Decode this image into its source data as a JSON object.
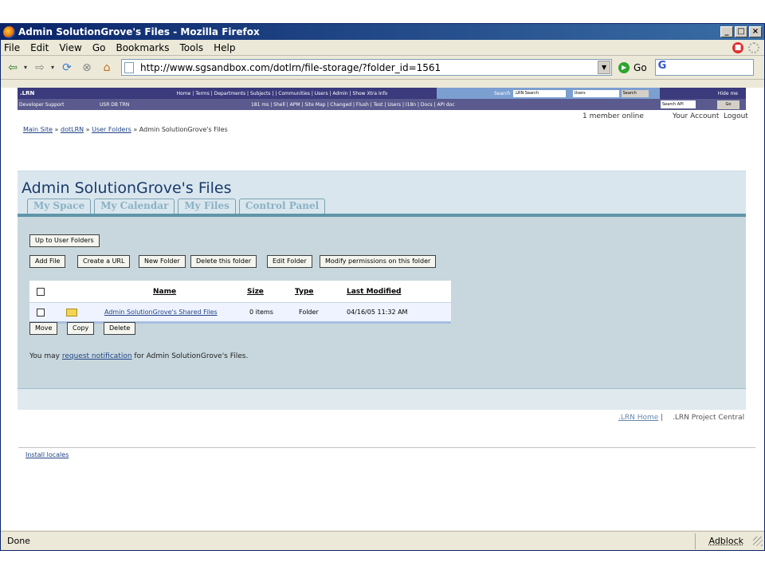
{
  "window": {
    "title": "Admin SolutionGrove's Files - Mozilla Firefox"
  },
  "menu": [
    "File",
    "Edit",
    "View",
    "Go",
    "Bookmarks",
    "Tools",
    "Help"
  ],
  "nav": {
    "url": "http://www.sgsandbox.com/dotlrn/file-storage/?folder_id=1561",
    "go_label": "Go",
    "search_logo": "G"
  },
  "lrn_toolbar": {
    "brand": ".LRN",
    "links": "Home | Terms | Departments | Subjects | | Communities | Users | Admin | Show Xtra Info",
    "search_label": "Search",
    "search_value": ".LRN Search",
    "select_value": "Users",
    "search_button": "Search",
    "hide": "Hide me"
  },
  "dev_toolbar": {
    "dev": "Developer Support",
    "usr": "USR DB TRN",
    "tools": "181 ms | Shell | APM | Site Map | Changed | Flush | Test | Users | I18n | Docs | API doc",
    "api_value": "Search API",
    "api_go": "Go"
  },
  "top_links": {
    "online": "1 member online",
    "account": "Your Account",
    "logout": "Logout"
  },
  "breadcrumb": {
    "main": "Main Site",
    "sep": "»",
    "dotlrn": "dotLRN",
    "user_folders": "User Folders",
    "current": "Admin SolutionGrove's Files"
  },
  "page": {
    "title": "Admin SolutionGrove's Files",
    "tabs": [
      "My Space",
      "My Calendar",
      "My Files",
      "Control Panel"
    ],
    "up_button": "Up to User Folders",
    "actions": [
      "Add File",
      "Create a URL",
      "New Folder",
      "Delete this folder",
      "Edit Folder",
      "Modify permissions on this folder"
    ],
    "table": {
      "headers": {
        "name": "Name",
        "size": "Size",
        "type": "Type",
        "modified": "Last Modified"
      },
      "rows": [
        {
          "name": "Admin SolutionGrove's Shared Files",
          "size": "0 items",
          "type": "Folder",
          "modified": "04/16/05 11:32 AM"
        }
      ]
    },
    "bulk": [
      "Move",
      "Copy",
      "Delete"
    ],
    "notice_pre": "You may",
    "notice_link": "request notification",
    "notice_post": "for Admin SolutionGrove's Files."
  },
  "footer": {
    "lrn_home": ".LRN Home",
    "sep": "|",
    "project": ".LRN Project Central",
    "install": "Install locales"
  },
  "status": {
    "text": "Done",
    "adblock": "Adblock"
  }
}
